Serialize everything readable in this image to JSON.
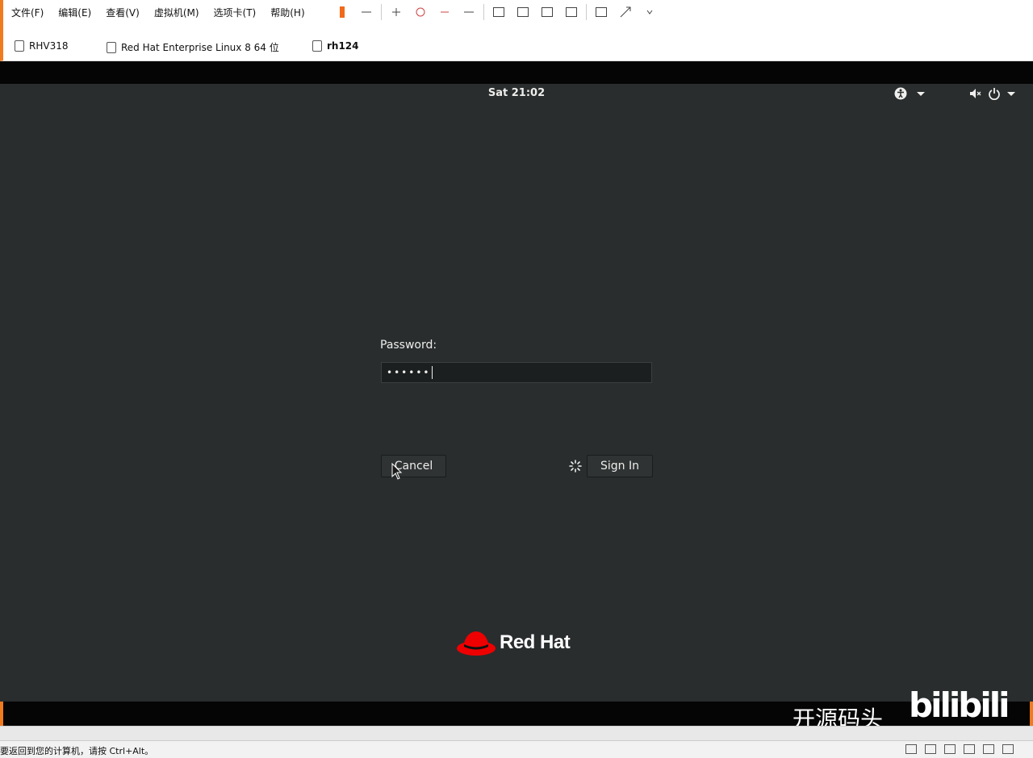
{
  "vmware": {
    "menu": [
      "文件(F)",
      "编辑(E)",
      "查看(V)",
      "虚拟机(M)",
      "选项卡(T)",
      "帮助(H)"
    ],
    "tabs": [
      {
        "label": "RHV318",
        "active": false
      },
      {
        "label": "Red Hat Enterprise Linux 8 64 位",
        "active": false
      },
      {
        "label": "rh124",
        "active": true
      }
    ],
    "status_text": "要返回到您的计算机，请按 Ctrl+Alt。",
    "accent_color": "#f07a1e"
  },
  "guest": {
    "clock": "Sat 21:02",
    "password_label": "Password:",
    "password_value": "••••••",
    "cancel_label": "Cancel",
    "signin_label": "Sign In",
    "logo_text": "Red Hat",
    "background_color": "#292d2e"
  },
  "watermark": {
    "channel": "开源码头",
    "site": "bilibili"
  }
}
